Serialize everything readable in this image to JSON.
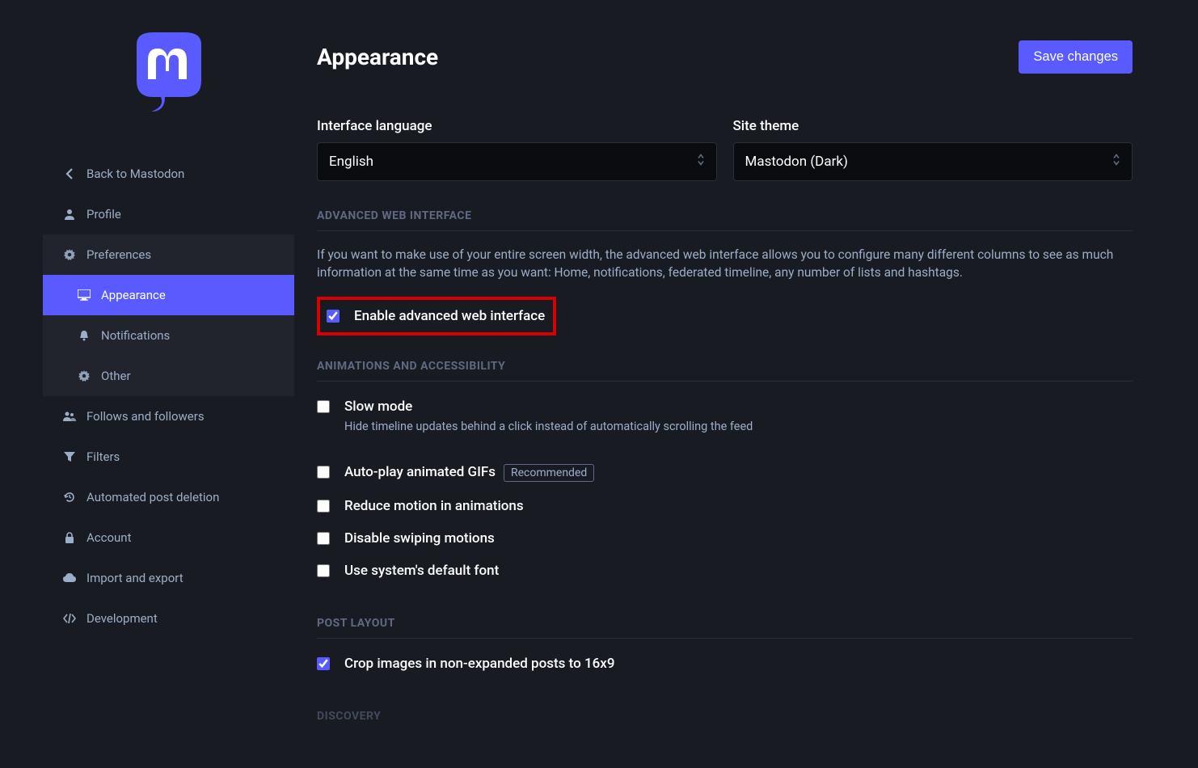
{
  "sidebar": {
    "back_label": "Back to Mastodon",
    "items": {
      "profile": "Profile",
      "preferences": "Preferences",
      "appearance": "Appearance",
      "notifications": "Notifications",
      "other": "Other",
      "follows": "Follows and followers",
      "filters": "Filters",
      "automated": "Automated post deletion",
      "account": "Account",
      "import_export": "Import and export",
      "development": "Development"
    }
  },
  "header": {
    "title": "Appearance",
    "save_label": "Save changes"
  },
  "fields": {
    "language_label": "Interface language",
    "language_value": "English",
    "theme_label": "Site theme",
    "theme_value": "Mastodon (Dark)"
  },
  "sections": {
    "advanced_heading": "ADVANCED WEB INTERFACE",
    "advanced_desc": "If you want to make use of your entire screen width, the advanced web interface allows you to configure many different columns to see as much information at the same time as you want: Home, notifications, federated timeline, any number of lists and hashtags.",
    "advanced_checkbox": "Enable advanced web interface",
    "anim_heading": "ANIMATIONS AND ACCESSIBILITY",
    "slow_mode": "Slow mode",
    "slow_mode_desc": "Hide timeline updates behind a click instead of automatically scrolling the feed",
    "autoplay": "Auto-play animated GIFs",
    "autoplay_badge": "Recommended",
    "reduce_motion": "Reduce motion in animations",
    "disable_swipe": "Disable swiping motions",
    "system_font": "Use system's default font",
    "post_layout_heading": "POST LAYOUT",
    "crop_images": "Crop images in non-expanded posts to 16x9",
    "discovery_heading": "DISCOVERY"
  },
  "colors": {
    "accent": "#595aff",
    "highlight": "#d80000"
  }
}
